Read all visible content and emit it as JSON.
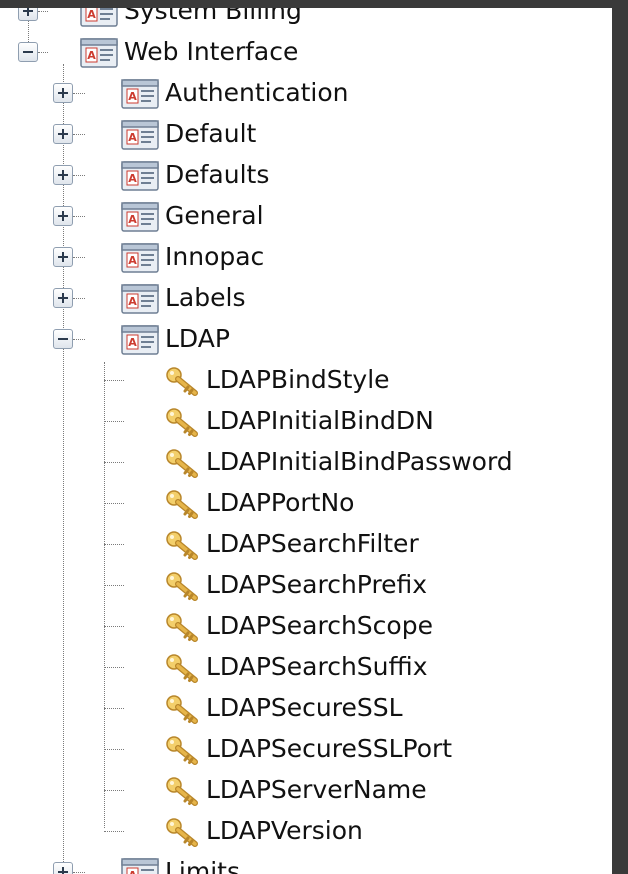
{
  "tree": {
    "top_items": [
      {
        "label": "System Billing",
        "state": "collapsed"
      },
      {
        "label": "Web Interface",
        "state": "expanded"
      }
    ],
    "web_interface_children": [
      {
        "label": "Authentication",
        "state": "collapsed"
      },
      {
        "label": "Default",
        "state": "collapsed"
      },
      {
        "label": "Defaults",
        "state": "collapsed"
      },
      {
        "label": "General",
        "state": "collapsed"
      },
      {
        "label": "Innopac",
        "state": "collapsed"
      },
      {
        "label": "Labels",
        "state": "collapsed"
      },
      {
        "label": "LDAP",
        "state": "expanded"
      }
    ],
    "ldap_keys": [
      "LDAPBindStyle",
      "LDAPInitialBindDN",
      "LDAPInitialBindPassword",
      "LDAPPortNo",
      "LDAPSearchFilter",
      "LDAPSearchPrefix",
      "LDAPSearchScope",
      "LDAPSearchSuffix",
      "LDAPSecureSSL",
      "LDAPSecureSSLPort",
      "LDAPServerName",
      "LDAPVersion"
    ],
    "trailing_item": {
      "label": "Limits",
      "state": "collapsed"
    }
  },
  "icons": {
    "folder_icon": "config-section-icon",
    "key_icon": "key-icon",
    "expand_icon": "plus-box-icon",
    "collapse_icon": "minus-box-icon"
  },
  "colors": {
    "key_gold": "#e6b54a",
    "section_red": "#cc3b2f",
    "frame": "#3a3a3a"
  }
}
